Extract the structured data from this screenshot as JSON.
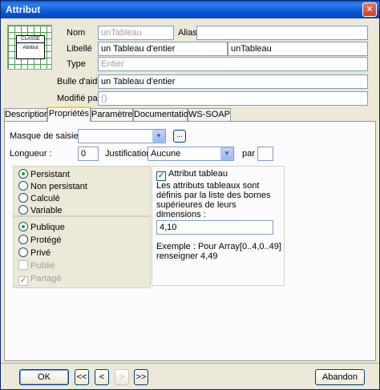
{
  "window": {
    "title": "Attribut",
    "close_glyph": "×"
  },
  "icon": {
    "name": "class-grid-icon",
    "top_text": "CLASSE",
    "bottom_text": "Attribut"
  },
  "header": {
    "nom_label": "Nom",
    "nom_value": "unTableau",
    "alias_label": "Alias",
    "alias_value": "",
    "libelle_label": "Libellé",
    "libelle_value1": "un Tableau d'entier",
    "libelle_value2": "unTableau",
    "type_label": "Type",
    "type_value": "Entier",
    "bulle_label": "Bulle d'aide",
    "bulle_value": "un Tableau d'entier",
    "modifie_label": "Modifié par",
    "modifie_value": "()"
  },
  "tabs": [
    {
      "label": "Description"
    },
    {
      "label": "Propriétés"
    },
    {
      "label": "Paramètres"
    },
    {
      "label": "Documentation"
    },
    {
      "label": "WS-SOAP"
    }
  ],
  "props": {
    "masque_label": "Masque de saisie :",
    "masque_value": "",
    "dots_label": "...",
    "longueur_label": "Longueur :",
    "longueur_value": "0",
    "justification_label": "Justification :",
    "justification_value": "Aucune",
    "par_label": "par",
    "par_value": ""
  },
  "persistence": [
    {
      "label": "Persistant",
      "selected": true
    },
    {
      "label": "Non persistant",
      "selected": false
    },
    {
      "label": "Calculé",
      "selected": false
    },
    {
      "label": "Variable",
      "selected": false
    }
  ],
  "visibility": {
    "radios": [
      {
        "label": "Publique",
        "selected": true
      },
      {
        "label": "Protégé",
        "selected": false
      },
      {
        "label": "Privé",
        "selected": false
      }
    ],
    "publie_label": "Publié",
    "partage_label": "Partagé"
  },
  "tableau": {
    "check_label": "Attribut tableau",
    "desc": "Les attributs tableaux sont définis par la liste des bornes supérieures de leurs dimensions :",
    "value": "4,10",
    "example": "Exemple : Pour Array[0..4,0..49] renseigner 4,49"
  },
  "buttons": {
    "ok": "OK",
    "first": "<<",
    "prev": "<",
    "next": ">",
    "last": ">>",
    "cancel": "Abandon"
  },
  "colors": {
    "titlebar": "#0b56d6",
    "face": "#ece9d8",
    "accent_tab": "#ffc83c"
  }
}
